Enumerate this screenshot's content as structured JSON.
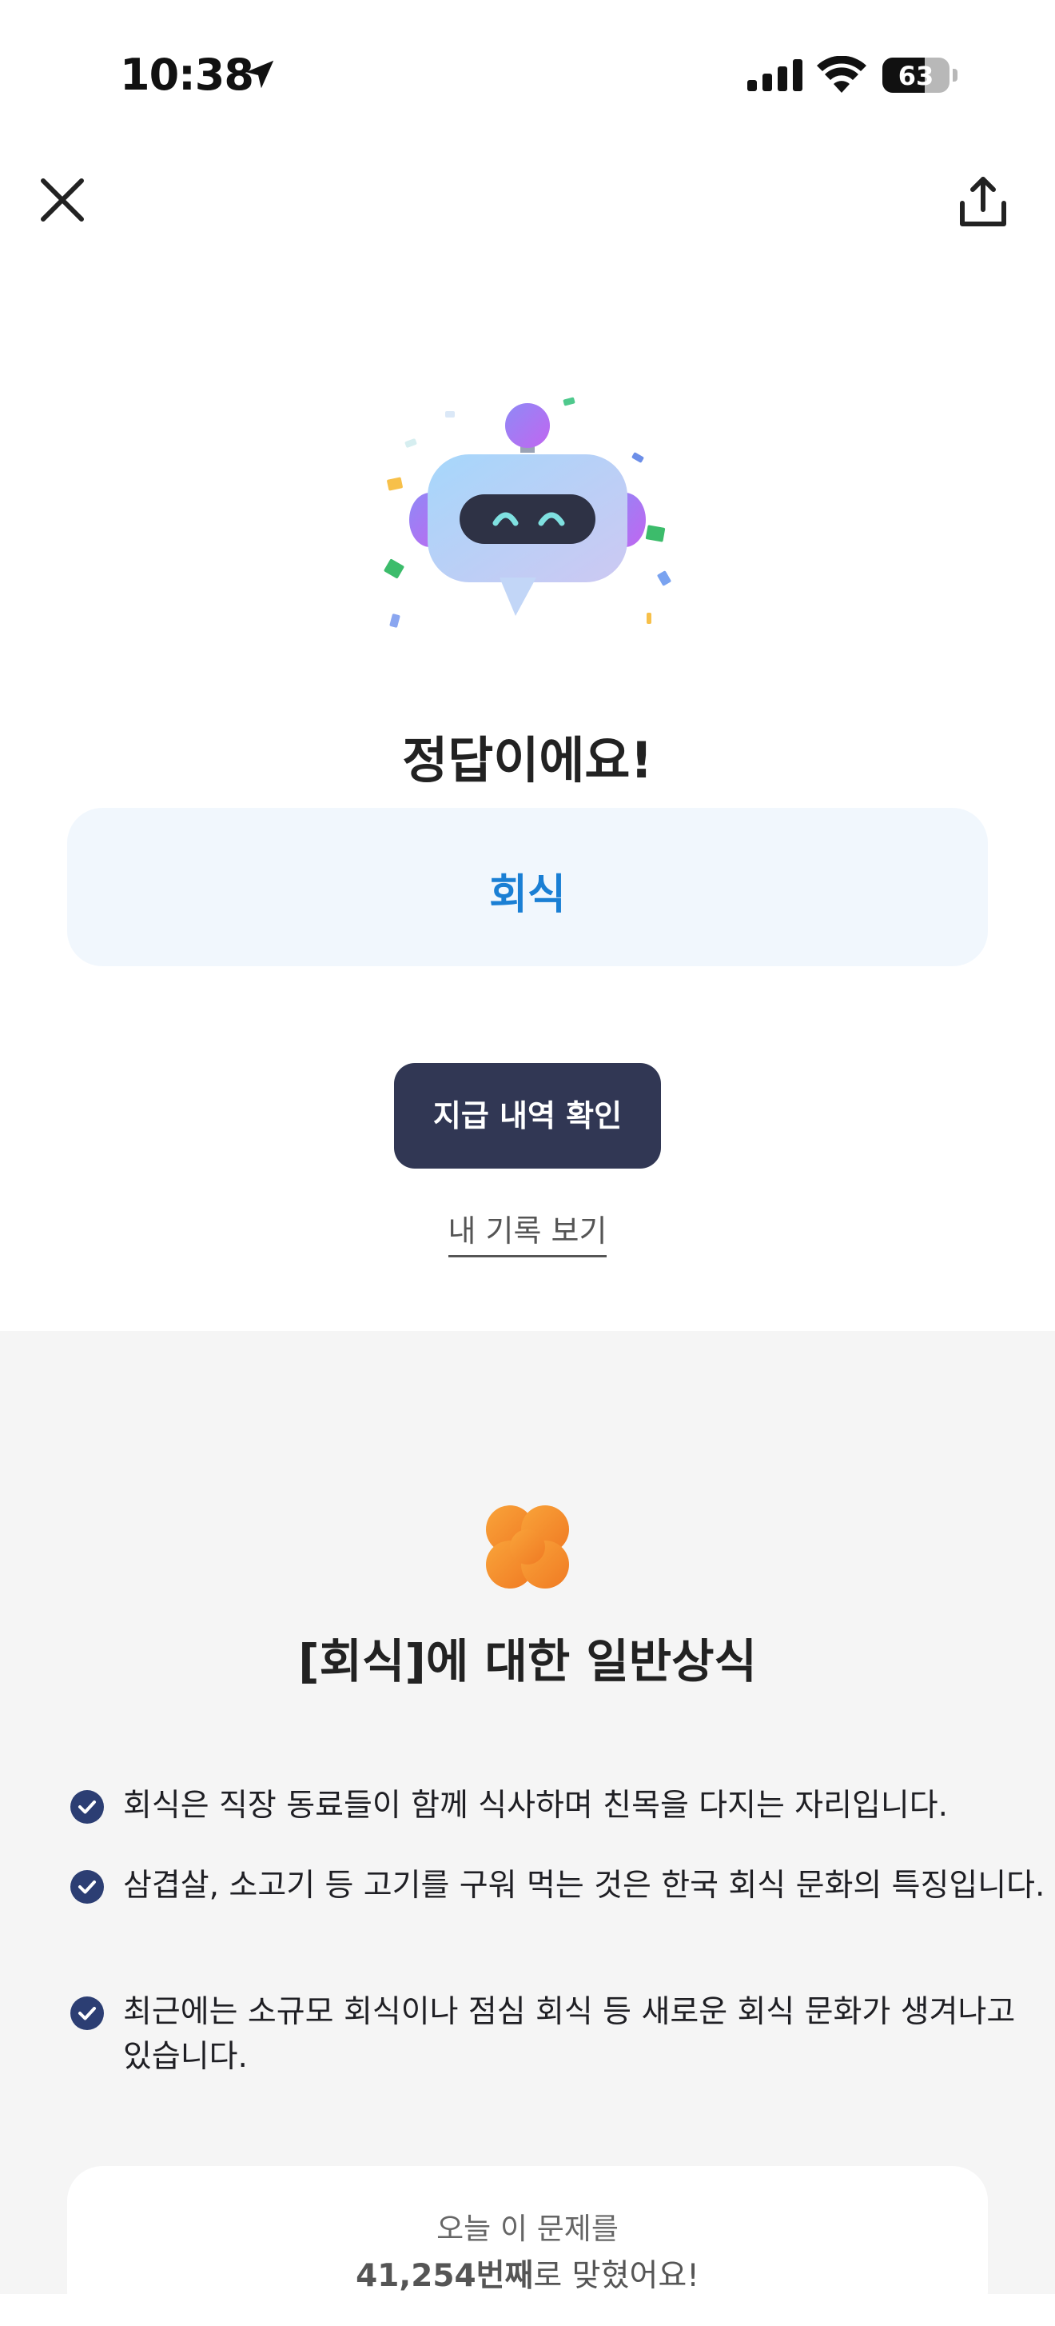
{
  "status_bar": {
    "time": "10:38",
    "battery": "63",
    "battery_level": 0.63,
    "icons": [
      "location-arrow-icon",
      "cellular-signal-icon",
      "wifi-icon",
      "battery-icon"
    ]
  },
  "nav": {
    "close_icon": "close-icon",
    "share_icon": "share-icon"
  },
  "result": {
    "title": "정답이에요!",
    "answer": "회식"
  },
  "actions": {
    "primary_label": "지급 내역 확인",
    "secondary_label": "내 기록 보기"
  },
  "knowledge": {
    "title": "[회식]에 대한 일반상식",
    "facts": [
      "회식은 직장 동료들이 함께 식사하며 친목을 다지는 자리입니다.",
      "삼겹살, 소고기 등 고기를 구워 먹는 것은 한국 회식 문화의 특징입니다.",
      "최근에는 소규모 회식이나 점심 회식 등 새로운 회식 문화가 생겨나고 있습니다."
    ]
  },
  "stats": {
    "line1": "오늘 이 문제를",
    "count": "41,254번째",
    "suffix": "로 맞혔어요!"
  },
  "colors": {
    "accent_blue": "#1a7fd4",
    "button_navy": "#313754",
    "answer_bg": "#f1f7fd",
    "section_bg": "#f5f5f5",
    "clover_orange": "#f7902a",
    "check_navy": "#2c3e73"
  }
}
